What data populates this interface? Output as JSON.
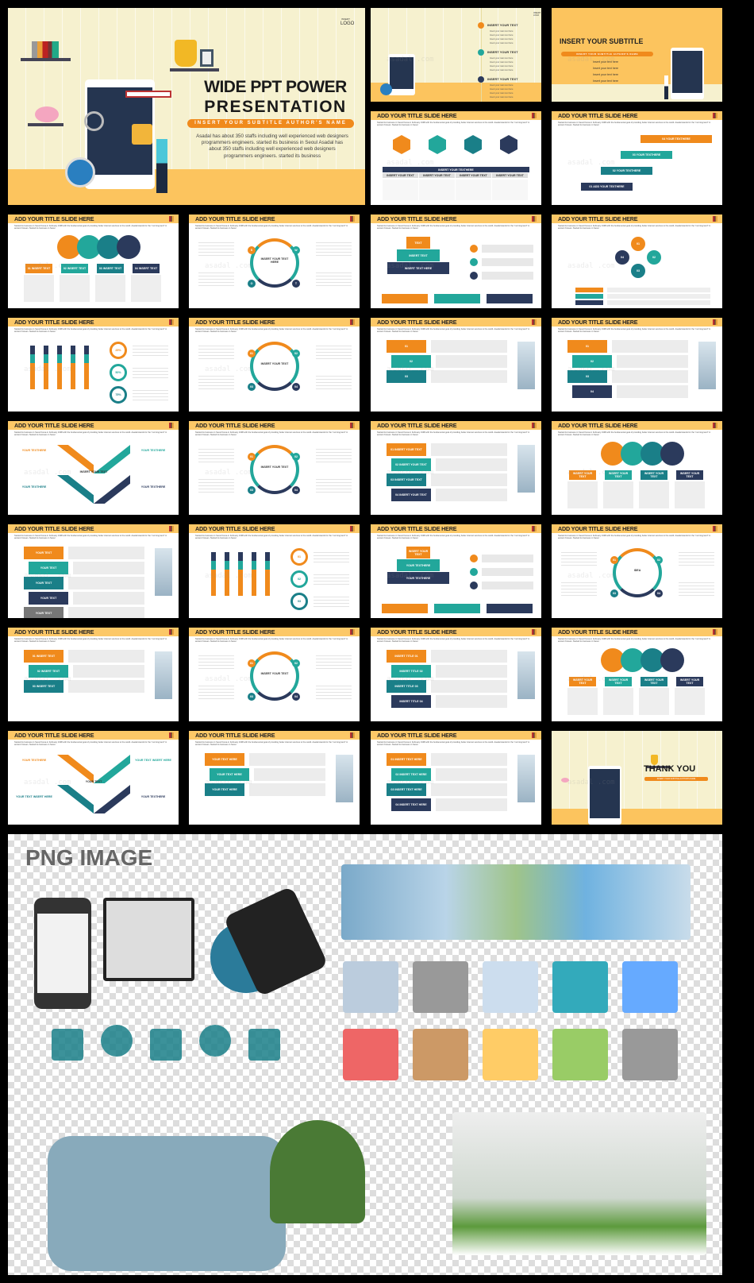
{
  "common": {
    "slide_title": "ADD YOUR TITLE SLIDE HERE",
    "desc": "Started its business in Seoul Korea in February 1998 with the fundamental goal of providing better internet services to the world. Asadal stands for the \"morning land\" in ancient Korean. Started its business in Seoul",
    "watermark": "asadal .com"
  },
  "colors": {
    "orange": "#f08a1c",
    "teal": "#22a79b",
    "darkteal": "#1a7f88",
    "navy": "#2b3a5c",
    "header": "#fcc867",
    "cream": "#f6f1cf",
    "floor": "#fcc45e"
  },
  "cover": {
    "logo_small": "INSERT",
    "logo": "LOGO",
    "title_line1": "WIDE PPT POWER",
    "title_line2": "PRESENTATION",
    "subtitle": "INSERT YOUR SUBTITLE AUTHOR'S NAME",
    "body": "Asadal has about 350 staffs including well experienced web designers programmers engineers. started its business in Seoul Asadal has about 350 staffs including well experienced web designers programmers engineers. started its business"
  },
  "agenda": {
    "logo": "INSERT LOGO",
    "items": [
      "INSERT YOUR TEXT",
      "INSERT YOUR TEXT",
      "INSERT YOUR TEXT"
    ],
    "bullet": "Insert your main text here"
  },
  "section": {
    "title": "INSERT YOUR SUBTITLE",
    "subtitle": "INSERT YOUR SUBTITLE AUTHOR'S NAME",
    "bullets": [
      "Insert your text here",
      "Insert your text here",
      "Insert your text here",
      "Insert your text here"
    ]
  },
  "thankyou": {
    "title": "THANK YOU",
    "subtitle": "INSERT YOUR SUBTITLE AUTHOR'S NAME"
  },
  "slides": [
    {
      "layout": "hex",
      "labels": [
        "INSERT YOUR TEXTHERE",
        "INSERT YOUR TEXT",
        "INSERT YOUR TEXT",
        "INSERT YOUR TEXT",
        "INSERT YOUR TEXT"
      ]
    },
    {
      "layout": "stairs",
      "labels": [
        "04 YOUR TEXTHERE",
        "03 YOUR TEXTHERE",
        "02 YOUR TEXTHERE",
        "01 ADD YOUR TEXTHERE"
      ]
    },
    {
      "layout": "circles",
      "labels": [
        "01 INSERT TEXT",
        "02 INSERT TEXT",
        "03 INSERT TEXT",
        "04 INSERT TEXT"
      ]
    },
    {
      "layout": "ring",
      "labels": [
        "INSERT YOUR TEXT HERE",
        "S",
        "W",
        "O",
        "T"
      ]
    },
    {
      "layout": "pyramid",
      "labels": [
        "TEXT",
        "INSERT TEXT",
        "INSERT TEXT HERE"
      ]
    },
    {
      "layout": "cycle",
      "labels": [
        "01",
        "02",
        "03",
        "04"
      ]
    },
    {
      "layout": "bars",
      "labels": [
        "25%",
        "50%",
        "75%"
      ]
    },
    {
      "layout": "ring",
      "labels": [
        "INSERT YOUR TEXT",
        "01",
        "02",
        "03",
        "04"
      ]
    },
    {
      "layout": "rows",
      "labels": [
        "01",
        "02",
        "03"
      ]
    },
    {
      "layout": "rows",
      "labels": [
        "01",
        "02",
        "03",
        "04"
      ]
    },
    {
      "layout": "x",
      "labels": [
        "YOUR TEXTHERE",
        "YOUR TEXTHERE",
        "YOUR TEXTHERE",
        "YOUR TEXTHERE",
        "INSERT YOUR TEXT"
      ]
    },
    {
      "layout": "ring",
      "labels": [
        "INSERT YOUR TEXT",
        "01",
        "02",
        "03",
        "04"
      ]
    },
    {
      "layout": "rows",
      "labels": [
        "01 INSERT YOUR TEXT",
        "02 INSERT YOUR TEXT",
        "03 INSERT YOUR TEXT",
        "04 INSERT YOUR TEXT"
      ]
    },
    {
      "layout": "circles",
      "labels": [
        "INSERT YOUR TEXT",
        "INSERT YOUR TEXT",
        "INSERT YOUR TEXT",
        "INSERT YOUR TEXT"
      ]
    },
    {
      "layout": "rows",
      "labels": [
        "YOUR TEXT",
        "YOUR TEXT",
        "YOUR TEXT",
        "YOUR TEXT",
        "YOUR TEXT"
      ]
    },
    {
      "layout": "bars",
      "labels": [
        "01",
        "02",
        "03"
      ]
    },
    {
      "layout": "pyramid",
      "labels": [
        "INSERT YOUR TEXT",
        "YOUR TEXTHERE",
        "YOUR TEXTHERE"
      ]
    },
    {
      "layout": "ring",
      "labels": [
        "IDEA",
        "01",
        "02",
        "03",
        "04"
      ]
    },
    {
      "layout": "rows",
      "labels": [
        "01 INSERT TEXT",
        "02 INSERT TEXT",
        "03 INSERT TEXT"
      ]
    },
    {
      "layout": "ring",
      "labels": [
        "INSERT YOUR TEXT",
        "01",
        "02",
        "03",
        "04"
      ]
    },
    {
      "layout": "rows",
      "labels": [
        "INSERT TITLE 01",
        "INSERT TITLE 02",
        "INSERT TITLE 03",
        "INSERT TITLE 04"
      ]
    },
    {
      "layout": "circles",
      "labels": [
        "INSERT YOUR TEXT",
        "INSERT YOUR TEXT",
        "INSERT YOUR TEXT",
        "INSERT YOUR TEXT"
      ]
    },
    {
      "layout": "x",
      "labels": [
        "YOUR TEXTHERE",
        "YOUR TEXT INSERT HERE",
        "YOUR TEXT INSERT HERE",
        "YOUR TEXTHERE",
        "YOUR TEXT"
      ]
    },
    {
      "layout": "rows",
      "labels": [
        "YOUR TEXT HERE",
        "YOUR TEXT HERE",
        "YOUR TEXT HERE"
      ]
    },
    {
      "layout": "rows",
      "labels": [
        "01 INSERT TEXT HERE",
        "02 INSERT TEXT HERE",
        "03 INSERT TEXT HERE",
        "04 INSERT TEXT HERE"
      ]
    }
  ],
  "png_panel": {
    "title": "PNG IMAGE"
  }
}
